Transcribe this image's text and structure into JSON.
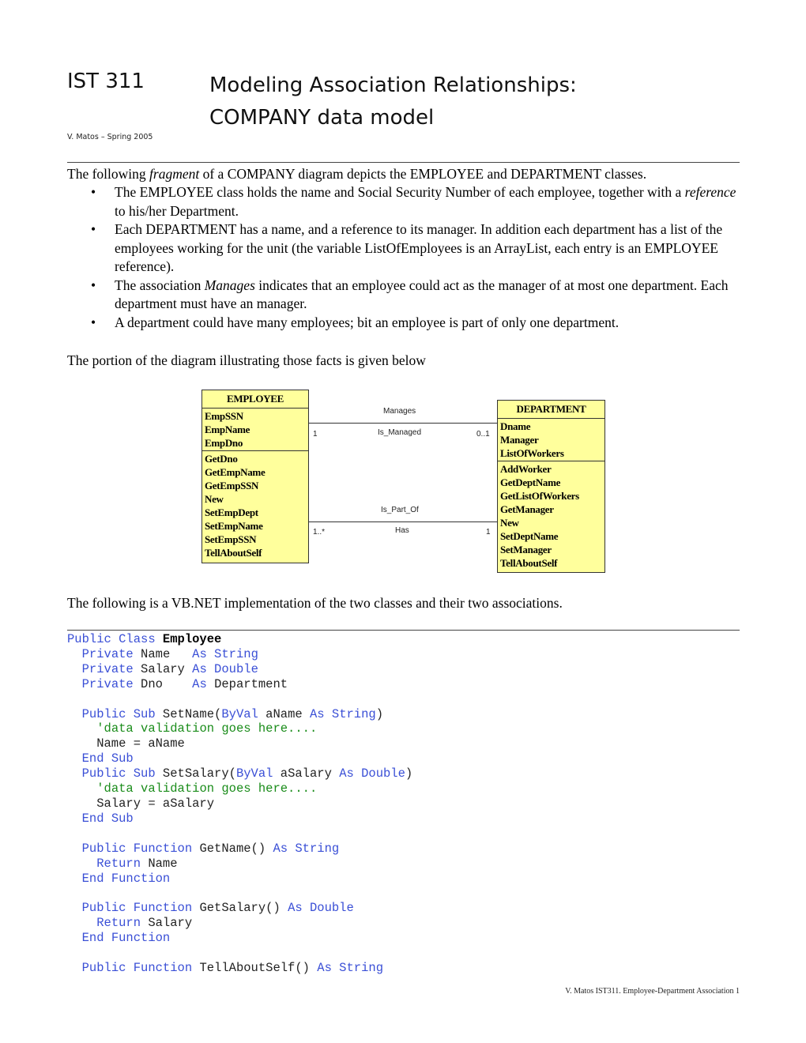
{
  "header": {
    "course": "IST 311",
    "title_line1": "Modeling Association Relationships:",
    "title_line2": "COMPANY data model",
    "author": "V. Matos – Spring 2005"
  },
  "intro": {
    "before": "The following ",
    "emph": "fragment",
    "after": " of a COMPANY diagram depicts the EMPLOYEE and DEPARTMENT classes."
  },
  "bullets": [
    {
      "parts": [
        {
          "t": "The EMPLOYEE class holds the name and Social Security Number of each employee, together with a "
        },
        {
          "t": "reference",
          "i": true
        },
        {
          "t": " to his/her Department."
        }
      ]
    },
    {
      "parts": [
        {
          "t": "Each DEPARTMENT has a name, and a reference to its manager. In addition each department has a list of the employees working for the unit (the variable ListOfEmployees is an ArrayList, each entry is an EMPLOYEE reference)."
        }
      ]
    },
    {
      "parts": [
        {
          "t": "The association "
        },
        {
          "t": "Manages",
          "i": true
        },
        {
          "t": " indicates that an employee could act as the manager of at most one department. Each department must have an manager."
        }
      ]
    },
    {
      "parts": [
        {
          "t": "A department could have many employees; bit an employee is part of only one department."
        }
      ]
    }
  ],
  "bullet_glyph": "•",
  "portion_text": "The portion of the diagram illustrating those facts is given below",
  "diagram": {
    "employee": {
      "name": "EMPLOYEE",
      "attributes": [
        "EmpSSN",
        "EmpName",
        "EmpDno"
      ],
      "methods": [
        "GetDno",
        "GetEmpName",
        "GetEmpSSN",
        "New",
        "SetEmpDept",
        "SetEmpName",
        "SetEmpSSN",
        "TellAboutSelf"
      ]
    },
    "department": {
      "name": "DEPARTMENT",
      "attributes": [
        "Dname",
        "Manager",
        "ListOfWorkers"
      ],
      "methods": [
        "AddWorker",
        "GetDeptName",
        "GetListOfWorkers",
        "GetManager",
        "New",
        "SetDeptName",
        "SetManager",
        "TellAboutSelf"
      ]
    },
    "associations": [
      {
        "top_label": "Manages",
        "bottom_label": "Is_Managed",
        "left_mult": "1",
        "right_mult": "0..1"
      },
      {
        "top_label": "Is_Part_Of",
        "bottom_label": "Has",
        "left_mult": "1..*",
        "right_mult": "1"
      }
    ]
  },
  "impl_text": "The following is a VB.NET implementation of the two classes and their two associations.",
  "code_lines": [
    [
      [
        "kw",
        "Public Class "
      ],
      [
        "bd",
        "Employee"
      ]
    ],
    [
      [
        "",
        "  "
      ],
      [
        "kw",
        "Private"
      ],
      [
        "",
        " Name   "
      ],
      [
        "kw",
        "As String"
      ]
    ],
    [
      [
        "",
        "  "
      ],
      [
        "kw",
        "Private"
      ],
      [
        "",
        " Salary "
      ],
      [
        "kw",
        "As Double"
      ]
    ],
    [
      [
        "",
        "  "
      ],
      [
        "kw",
        "Private"
      ],
      [
        "",
        " Dno    "
      ],
      [
        "kw",
        "As"
      ],
      [
        "",
        " Department"
      ]
    ],
    [],
    [
      [
        "",
        "  "
      ],
      [
        "kw",
        "Public Sub"
      ],
      [
        "",
        " SetName("
      ],
      [
        "kw",
        "ByVal"
      ],
      [
        "",
        " aName "
      ],
      [
        "kw",
        "As String"
      ],
      [
        "",
        ")"
      ]
    ],
    [
      [
        "",
        "    "
      ],
      [
        "cm",
        "'data validation goes here...."
      ]
    ],
    [
      [
        "",
        "    Name = aName"
      ]
    ],
    [
      [
        "",
        "  "
      ],
      [
        "kw",
        "End Sub"
      ]
    ],
    [
      [
        "",
        "  "
      ],
      [
        "kw",
        "Public Sub"
      ],
      [
        "",
        " SetSalary("
      ],
      [
        "kw",
        "ByVal"
      ],
      [
        "",
        " aSalary "
      ],
      [
        "kw",
        "As Double"
      ],
      [
        "",
        ")"
      ]
    ],
    [
      [
        "",
        "    "
      ],
      [
        "cm",
        "'data validation goes here...."
      ]
    ],
    [
      [
        "",
        "    Salary = aSalary"
      ]
    ],
    [
      [
        "",
        "  "
      ],
      [
        "kw",
        "End Sub"
      ]
    ],
    [],
    [
      [
        "",
        "  "
      ],
      [
        "kw",
        "Public Function"
      ],
      [
        "",
        " GetName() "
      ],
      [
        "kw",
        "As String"
      ]
    ],
    [
      [
        "",
        "    "
      ],
      [
        "kw",
        "Return"
      ],
      [
        "",
        " Name"
      ]
    ],
    [
      [
        "",
        "  "
      ],
      [
        "kw",
        "End Function"
      ]
    ],
    [],
    [
      [
        "",
        "  "
      ],
      [
        "kw",
        "Public Function"
      ],
      [
        "",
        " GetSalary() "
      ],
      [
        "kw",
        "As Double"
      ]
    ],
    [
      [
        "",
        "    "
      ],
      [
        "kw",
        "Return"
      ],
      [
        "",
        " Salary"
      ]
    ],
    [
      [
        "",
        "  "
      ],
      [
        "kw",
        "End Function"
      ]
    ],
    [],
    [
      [
        "",
        "  "
      ],
      [
        "kw",
        "Public Function"
      ],
      [
        "",
        " TellAboutSelf() "
      ],
      [
        "kw",
        "As String"
      ]
    ]
  ],
  "footer": "V. Matos IST311. Employee-Department Association  1"
}
